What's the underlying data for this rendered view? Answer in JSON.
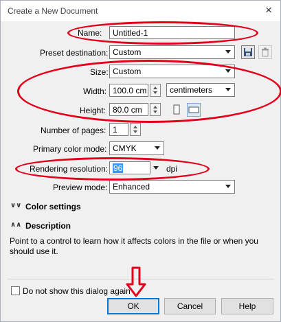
{
  "window": {
    "title": "Create a New Document",
    "close_icon": "×"
  },
  "fields": {
    "name_label": "Name:",
    "name_value": "Untitled-1",
    "preset_label": "Preset destination:",
    "preset_value": "Custom",
    "size_label": "Size:",
    "size_value": "Custom",
    "width_label": "Width:",
    "width_value": "100.0 cm",
    "units_value": "centimeters",
    "height_label": "Height:",
    "height_value": "80.0 cm",
    "pages_label": "Number of pages:",
    "pages_value": "1",
    "color_mode_label": "Primary color mode:",
    "color_mode_value": "CMYK",
    "resolution_label": "Rendering resolution:",
    "resolution_value": "96",
    "resolution_unit": "dpi",
    "preview_label": "Preview mode:",
    "preview_value": "Enhanced"
  },
  "sections": {
    "color_settings": "Color settings",
    "description": "Description",
    "description_text": "Point to a control to learn how it affects colors in the file or when you should use it."
  },
  "footer": {
    "checkbox_label": "Do not show this dialog again",
    "ok": "OK",
    "cancel": "Cancel",
    "help": "Help"
  },
  "colors": {
    "annotation": "#e3001b",
    "selection": "#3399ff"
  }
}
